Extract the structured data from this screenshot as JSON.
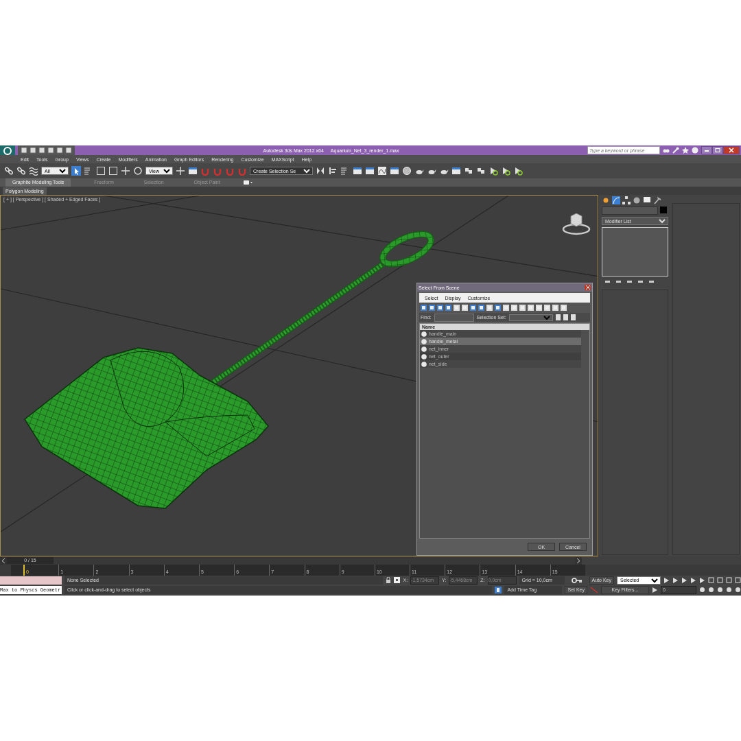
{
  "window": {
    "app": "Autodesk 3ds Max  2012 x64",
    "file": "Aquarium_Net_3_render_1.max",
    "search": {
      "placeholder": "Type a keyword or phrase"
    }
  },
  "menu": [
    "Edit",
    "Tools",
    "Group",
    "Views",
    "Create",
    "Modifiers",
    "Animation",
    "Graph Editors",
    "Rendering",
    "Customize",
    "MAXScript",
    "Help"
  ],
  "toolbar": {
    "selection_filter": "All",
    "reference_coord": "View",
    "named_selection": "Create Selection Se"
  },
  "ribbon": {
    "tabs": [
      {
        "label": "Graphite Modeling Tools",
        "selected": true
      },
      {
        "label": "Freeform",
        "selected": false
      },
      {
        "label": "Selection",
        "selected": false
      },
      {
        "label": "Object Paint",
        "selected": false
      }
    ],
    "panel": "Polygon Modeling"
  },
  "viewport": {
    "label": "[ + ] [ Perspective ] [ Shaded + Edged Faces ]"
  },
  "dialog": {
    "title": "Select From Scene",
    "menu": [
      "Select",
      "Display",
      "Customize"
    ],
    "find_label": "Find:",
    "selection_set_label": "Selection Set:",
    "column": "Name",
    "rows": [
      {
        "name": "handle_main",
        "selected": false
      },
      {
        "name": "handle_metal",
        "selected": true
      },
      {
        "name": "net_inner",
        "selected": false
      },
      {
        "name": "net_outer",
        "selected": false
      },
      {
        "name": "net_side",
        "selected": false
      }
    ],
    "buttons": [
      "OK",
      "Cancel"
    ]
  },
  "command_panel": {
    "modifier_list": "Modifier List"
  },
  "timeline": {
    "frame": "0 / 15",
    "level": 0,
    "ticks": [
      "0",
      "1",
      "2",
      "3",
      "4",
      "5",
      "6",
      "7",
      "8",
      "9",
      "10",
      "11",
      "12",
      "13",
      "14",
      "15"
    ]
  },
  "status": {
    "listener": "Max to Physcs Geometr",
    "selection": "None Selected",
    "prompt": "Click or click-and-drag to select objects",
    "x_label": "X:",
    "x": "-1,5734cm",
    "y_label": "Y:",
    "y": "-5,4468cm",
    "z_label": "Z:",
    "z": "0,0cm",
    "grid": "Grid = 10,0cm",
    "time_tag": "Add Time Tag",
    "auto_key": "Auto Key",
    "set_key": "Set Key",
    "key_mode": "Selected",
    "key_filters": "Key Filters...",
    "frame_field": "0"
  }
}
